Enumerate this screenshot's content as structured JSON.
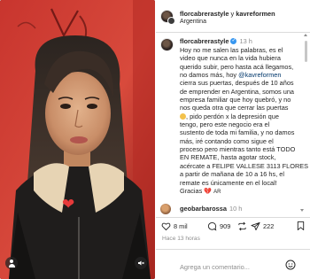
{
  "post": {
    "header": {
      "author": "florcabrerastyle",
      "joiner": "y",
      "collaborator": "kavreformen",
      "location": "Argentina"
    },
    "caption": {
      "author": "florcabrerastyle",
      "time": "13 h",
      "lines": [
        "Hoy no me salen las palabras, es el",
        "video que nunca en la vida hubiera",
        "querido subir, pero hasta acá llegamos,",
        "no damos más, hoy ",
        "cierra sus puertas, después de 10 años",
        "de emprender en Argentina, somos una",
        "empresa familiar que hoy quebró, y no",
        "nos queda otra que cerrar las puertas",
        ", pido perdón x la depresión que",
        "tengo, pero este negocio era el",
        "sustento de toda mi familia, y no damos",
        "más, iré contando como sigue el",
        "proceso pero mientras tanto está TODO",
        "EN REMATE, hasta agotar stock,",
        "acércate a FELIPE VALLESE 3113 FLORES",
        "a partir de mañana de 10 a 16 hs, el",
        "remate es únicamente en el local!",
        "Gracias ",
        "AR"
      ],
      "mention": "@kavreformen",
      "emoji_heart": "💔"
    },
    "comment2": {
      "author": "geobarbarossa",
      "time": "10 h"
    },
    "actions": {
      "likes": "8 mil",
      "comments": "909",
      "shares": "222"
    },
    "time_ago": "Hace 13 horas",
    "add_comment": {
      "placeholder": "Agrega un comentario..."
    },
    "colors": {
      "text": "#262626",
      "muted": "#8e8e8e",
      "mention": "#00376b",
      "verified": "#3897f0",
      "heart": "#e63a3a"
    },
    "icons": {
      "like": "heart-outline-icon",
      "comment": "speech-bubble-icon",
      "share": "repost-icon",
      "save": "bookmark-icon",
      "emoji": "smiley-icon"
    }
  }
}
